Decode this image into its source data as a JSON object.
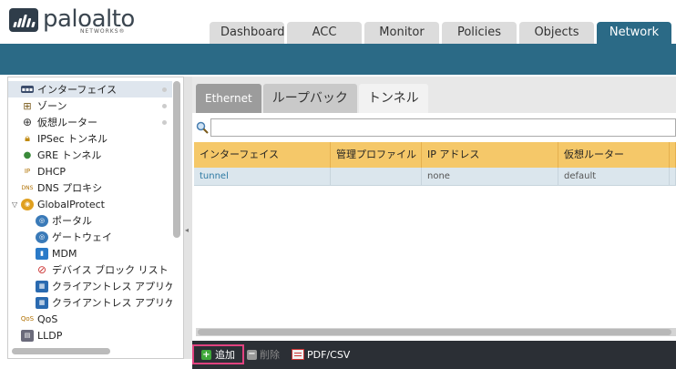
{
  "brand": {
    "name": "paloalto",
    "sub": "NETWORKS®"
  },
  "main_tabs": [
    "Dashboard",
    "ACC",
    "Monitor",
    "Policies",
    "Objects",
    "Network"
  ],
  "active_main_tab": "Network",
  "sidebar": {
    "items": [
      {
        "label": "インターフェイス",
        "icon": "interface-icon",
        "selected": true
      },
      {
        "label": "ゾーン",
        "icon": "zone-icon"
      },
      {
        "label": "仮想ルーター",
        "icon": "router-icon"
      },
      {
        "label": "IPSec トンネル",
        "icon": "ipsec-lock-icon"
      },
      {
        "label": "GRE トンネル",
        "icon": "gre-tunnel-icon"
      },
      {
        "label": "DHCP",
        "icon": "dhcp-icon"
      },
      {
        "label": "DNS プロキシ",
        "icon": "dns-icon"
      },
      {
        "label": "GlobalProtect",
        "icon": "globalprotect-icon"
      },
      {
        "label": "ポータル",
        "icon": "portal-icon"
      },
      {
        "label": "ゲートウェイ",
        "icon": "gateway-icon"
      },
      {
        "label": "MDM",
        "icon": "mdm-icon"
      },
      {
        "label": "デバイス ブロック リスト",
        "icon": "blocklist-icon"
      },
      {
        "label": "クライアントレス アプリケ",
        "icon": "clientless-app-icon"
      },
      {
        "label": "クライアントレス アプリケ",
        "icon": "clientless-app-icon"
      },
      {
        "label": "QoS",
        "icon": "qos-icon"
      },
      {
        "label": "LLDP",
        "icon": "lldp-icon"
      }
    ]
  },
  "sub_tabs": [
    "Ethernet",
    "ループバック",
    "トンネル"
  ],
  "active_sub_tab": "トンネル",
  "search": {
    "value": "",
    "placeholder": ""
  },
  "table": {
    "headers": [
      "インターフェイス",
      "管理プロファイル",
      "IP アドレス",
      "仮想ルーター",
      ""
    ],
    "rows": [
      [
        "tunnel",
        "",
        "none",
        "default",
        ""
      ]
    ]
  },
  "footer": {
    "add": "追加",
    "delete": "削除",
    "export": "PDF/CSV"
  },
  "colors": {
    "accent": "#2b6a86",
    "header_row": "#f5c869",
    "add_highlight": "#e0427f"
  }
}
